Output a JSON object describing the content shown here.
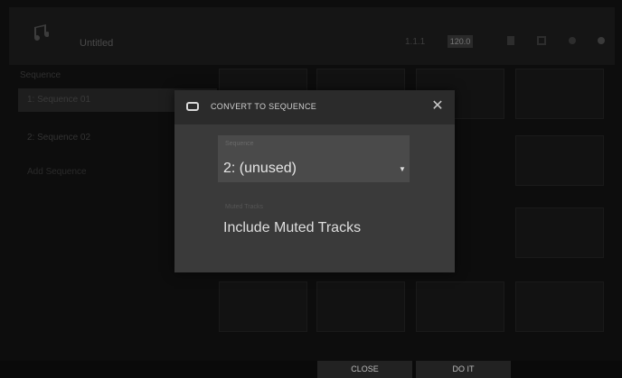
{
  "topbar": {
    "song_name": "Untitled",
    "counter": "1.1.1",
    "tempo": "120.0"
  },
  "background": {
    "header": "Sequence",
    "rows": [
      "1: Sequence 01",
      "2: Sequence 02",
      "Add Sequence"
    ]
  },
  "dialog": {
    "title": "CONVERT TO SEQUENCE",
    "sequence_field": {
      "label": "Sequence",
      "value": "2: (unused)"
    },
    "muted_field": {
      "label": "Muted Tracks",
      "value": "Include Muted Tracks"
    }
  },
  "buttons": {
    "close": "CLOSE",
    "do_it": "DO IT"
  },
  "colors": {
    "dialog_bg": "#3a3a3a",
    "dialog_header": "#2b2b2b",
    "field_bg": "#4a4a4a"
  }
}
